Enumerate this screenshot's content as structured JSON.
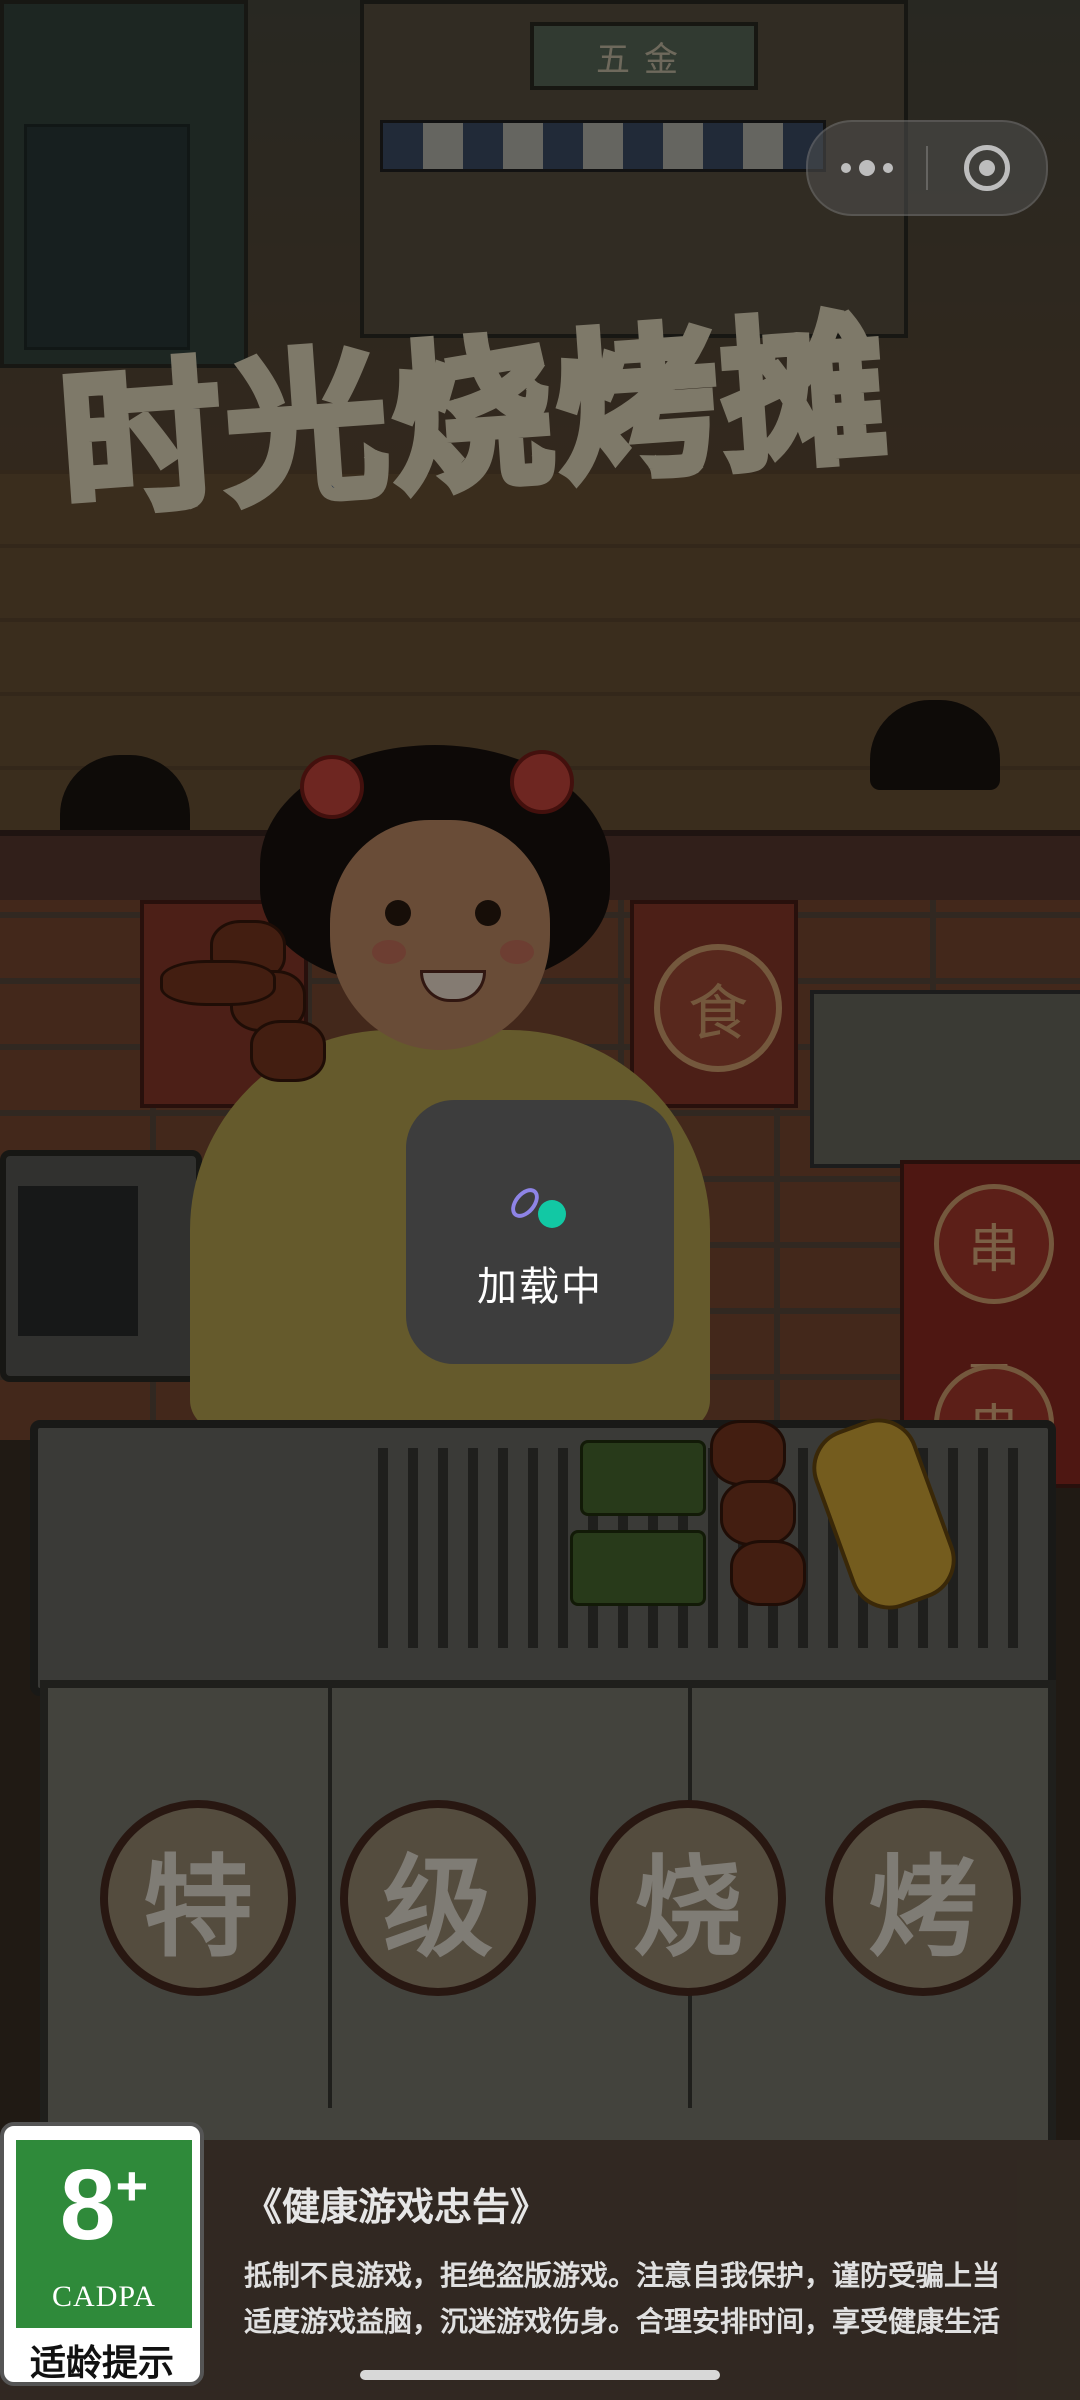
{
  "game": {
    "title": "时光烧烤摊",
    "shop_sign": "五金",
    "medal_char": "食",
    "side_banner_chars": [
      "串",
      "一",
      "串"
    ],
    "grill_badges": [
      "特",
      "级",
      "烧",
      "烤"
    ]
  },
  "capsule": {
    "more_icon": "more-dots-icon",
    "close_icon": "close-target-icon"
  },
  "loading": {
    "text": "加载中",
    "spinner_colors": {
      "ring": "#8e84e6",
      "dot": "#12c8a4"
    }
  },
  "age_rating": {
    "number": "8",
    "plus": "+",
    "org": "CADPA",
    "label": "适龄提示",
    "color": "#2f8a3a"
  },
  "advisory": {
    "title": "《健康游戏忠告》",
    "lines": [
      "抵制不良游戏，拒绝盗版游戏。注意自我保护，谨防受骗上当",
      "适度游戏益脑，沉迷游戏伤身。合理安排时间，享受健康生活"
    ]
  }
}
